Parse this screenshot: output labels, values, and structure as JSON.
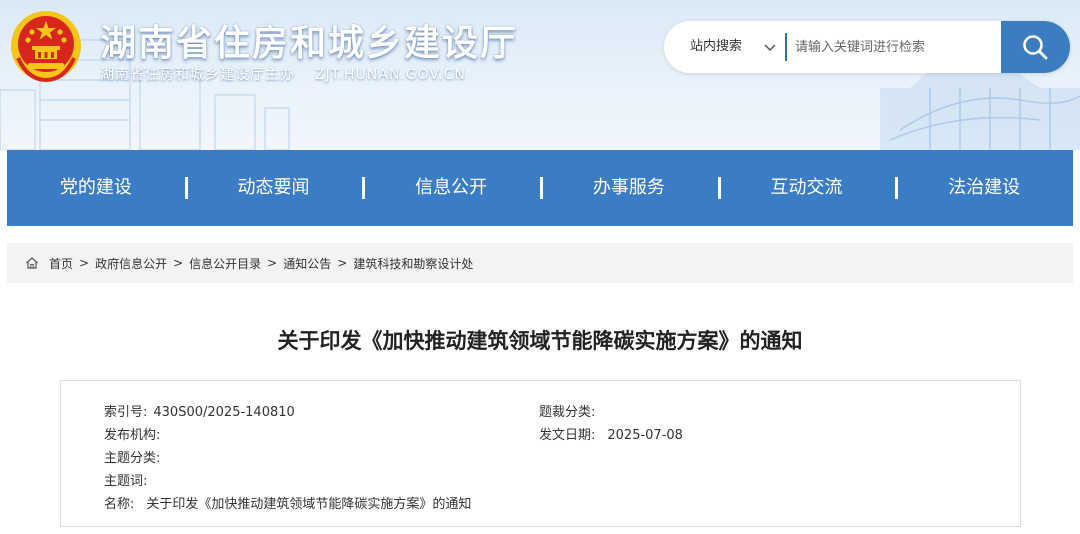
{
  "header": {
    "site_title": "湖南省住房和城乡建设厅",
    "sponsor": "湖南省住房和城乡建设厅主办",
    "domain": "ZJT.HUNAN.GOV.CN",
    "colors": {
      "accent": "#3a7dc4",
      "emblem_red": "#d9261c",
      "emblem_gold": "#f5c518"
    }
  },
  "search": {
    "scope_label": "站内搜索",
    "placeholder": "请输入关键词进行检索",
    "chevron_icon": "chevron-down-icon",
    "button_icon": "search-icon"
  },
  "nav": {
    "items": [
      {
        "label": "党的建设"
      },
      {
        "label": "动态要闻"
      },
      {
        "label": "信息公开"
      },
      {
        "label": "办事服务"
      },
      {
        "label": "互动交流"
      },
      {
        "label": "法治建设"
      }
    ]
  },
  "breadcrumb": {
    "home_icon": "home-icon",
    "separator": ">",
    "items": [
      {
        "label": "首页"
      },
      {
        "label": "政府信息公开"
      },
      {
        "label": "信息公开目录"
      },
      {
        "label": "通知公告"
      },
      {
        "label": "建筑科技和勘察设计处"
      }
    ]
  },
  "article": {
    "title": "关于印发《加快推动建筑领域节能降碳实施方案》的通知",
    "meta": {
      "index_label": "索引号:",
      "index_value": "430S00/2025-140810",
      "genre_label": "题裁分类:",
      "genre_value": "",
      "org_label": "发布机构:",
      "org_value": "",
      "date_label": "发文日期:",
      "date_value": "2025-07-08",
      "topic_label": "主题分类:",
      "topic_value": "",
      "keywords_label": "主题词:",
      "keywords_value": "",
      "name_label": "名称:",
      "name_value": "关于印发《加快推动建筑领域节能降碳实施方案》的通知"
    }
  }
}
